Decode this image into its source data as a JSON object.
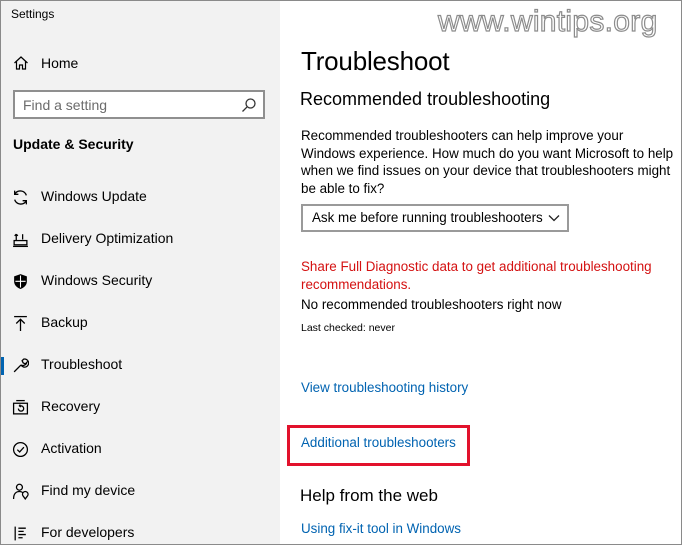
{
  "window": {
    "title": "Settings"
  },
  "watermark": {
    "text": "www.wintips.org"
  },
  "sidebar": {
    "home": {
      "label": "Home",
      "icon": "home-icon"
    },
    "search": {
      "placeholder": "Find a setting",
      "icon": "search-icon"
    },
    "section_title": "Update & Security",
    "items": [
      {
        "label": "Windows Update",
        "icon": "sync-icon"
      },
      {
        "label": "Delivery Optimization",
        "icon": "delivery-optimization-icon"
      },
      {
        "label": "Windows Security",
        "icon": "shield-icon"
      },
      {
        "label": "Backup",
        "icon": "backup-icon"
      },
      {
        "label": "Troubleshoot",
        "icon": "wrench-icon",
        "active": true
      },
      {
        "label": "Recovery",
        "icon": "recovery-icon"
      },
      {
        "label": "Activation",
        "icon": "activation-icon"
      },
      {
        "label": "Find my device",
        "icon": "person-location-icon"
      },
      {
        "label": "For developers",
        "icon": "developer-icon"
      }
    ]
  },
  "main": {
    "title": "Troubleshoot",
    "subtitle": "Recommended troubleshooting",
    "description": "Recommended troubleshooters can help improve your Windows experience. How much do you want Microsoft to help when we find issues on your device that troubleshooters might be able to fix?",
    "dropdown": {
      "selected": "Ask me before running troubleshooters"
    },
    "diagnostic_link": "Share Full Diagnostic data to get additional troubleshooting recommendations.",
    "status": "No recommended troubleshooters right now",
    "last_checked": "Last checked: never",
    "history_link": "View troubleshooting history",
    "additional_link": "Additional troubleshooters",
    "help_title": "Help from the web",
    "fixit_link": "Using fix-it tool in Windows"
  },
  "colors": {
    "accent": "#0063b1",
    "warning_link": "#d41111",
    "highlight_box": "#e2122c",
    "sidebar_bg": "#f2f2f2"
  }
}
